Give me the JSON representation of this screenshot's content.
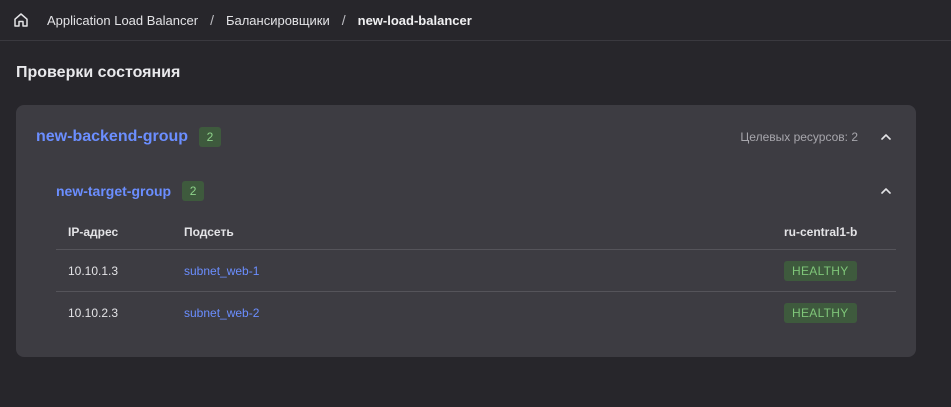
{
  "breadcrumb": {
    "items": [
      "Application Load Balancer",
      "Балансировщики",
      "new-load-balancer"
    ],
    "separator": "/"
  },
  "page": {
    "title": "Проверки состояния"
  },
  "backend_group": {
    "name": "new-backend-group",
    "count": "2",
    "targets_label": "Целевых ресурсов: 2"
  },
  "target_group": {
    "name": "new-target-group",
    "count": "2",
    "columns": {
      "ip": "IP-адрес",
      "subnet": "Подсеть",
      "zone": "ru-central1-b"
    },
    "rows": [
      {
        "ip": "10.10.1.3",
        "subnet": "subnet_web-1",
        "status": "HEALTHY"
      },
      {
        "ip": "10.10.2.3",
        "subnet": "subnet_web-2",
        "status": "HEALTHY"
      }
    ]
  },
  "colors": {
    "link": "#6b8eff",
    "healthy_bg": "#3e5a3d",
    "healthy_text": "#7fc679",
    "card": "#3d3c42",
    "background": "#27262b"
  }
}
